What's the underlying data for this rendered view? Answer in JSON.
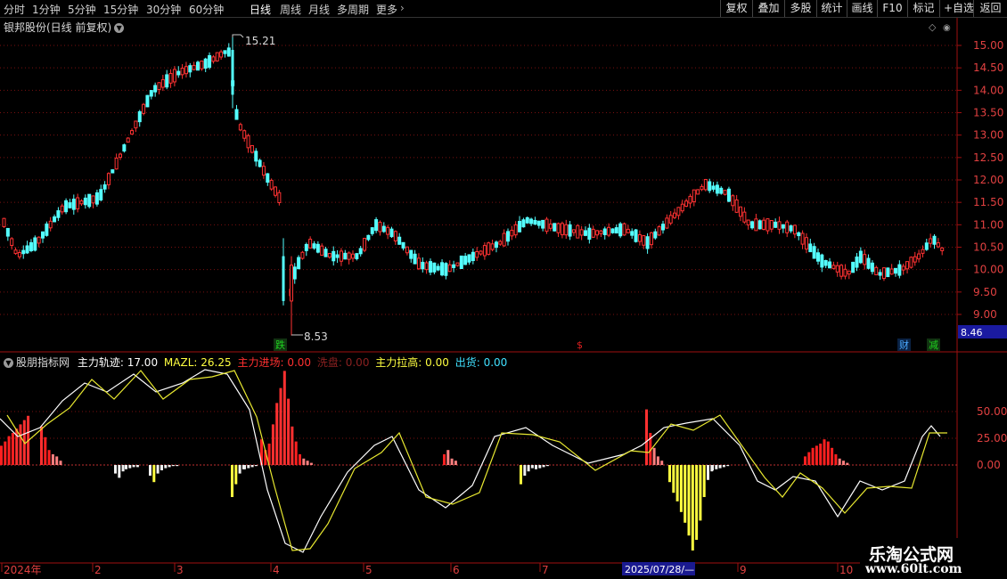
{
  "toolbar": {
    "timeframes": [
      "分时",
      "1分钟",
      "5分钟",
      "15分钟",
      "30分钟",
      "60分钟",
      "日线",
      "周线",
      "月线",
      "多周期",
      "更多"
    ],
    "active_timeframe": "日线",
    "right_buttons": [
      "复权",
      "叠加",
      "多股",
      "统计",
      "画线",
      "F10",
      "标记",
      "+自选",
      "返回"
    ]
  },
  "main_panel": {
    "title": "银邦股份(日线 前复权)",
    "price_labels": [
      "15.00",
      "14.50",
      "14.00",
      "13.50",
      "13.00",
      "12.50",
      "12.00",
      "11.50",
      "11.00",
      "10.50",
      "10.00",
      "9.50",
      "9.00"
    ],
    "current_price": "8.46",
    "high_label": "15.21",
    "low_label": "8.53",
    "markers": [
      {
        "text": "跌",
        "color": "#1fd21f",
        "bg": "#113311"
      },
      {
        "text": "$",
        "color": "#e02020",
        "bg": "#000000"
      },
      {
        "text": "财",
        "color": "#4aa8ff",
        "bg": "#0a2244"
      },
      {
        "text": "减",
        "color": "#1fd21f",
        "bg": "#113311"
      }
    ]
  },
  "indicator_panel": {
    "name": "股朋指标网",
    "items": [
      {
        "label": "主力轨迹:",
        "value": "17.00",
        "color": "#ffffff"
      },
      {
        "label": "MAZL:",
        "value": "26.25",
        "color": "#ffff40"
      },
      {
        "label": "主力进场:",
        "value": "0.00",
        "color": "#ff3030"
      },
      {
        "label": "洗盘:",
        "value": "0.00",
        "color": "#8a2020"
      },
      {
        "label": "主力拉高:",
        "value": "0.00",
        "color": "#ffff40"
      },
      {
        "label": "出货:",
        "value": "0.00",
        "color": "#40e0ff"
      }
    ],
    "axis_labels": [
      "50.00",
      "25.00",
      "0.00"
    ]
  },
  "time_axis": {
    "labels": [
      "2024年",
      "2",
      "3",
      "4",
      "5",
      "6",
      "7",
      "8",
      "9",
      "10"
    ],
    "cursor_date": "2025/07/28/—"
  },
  "watermark": {
    "line1": "乐淘公式网",
    "line2": "www.60lt.com"
  },
  "colors": {
    "up": "#ff3232",
    "down": "#54ffff",
    "grid": "#7a1010",
    "axis": "#a01010"
  }
}
